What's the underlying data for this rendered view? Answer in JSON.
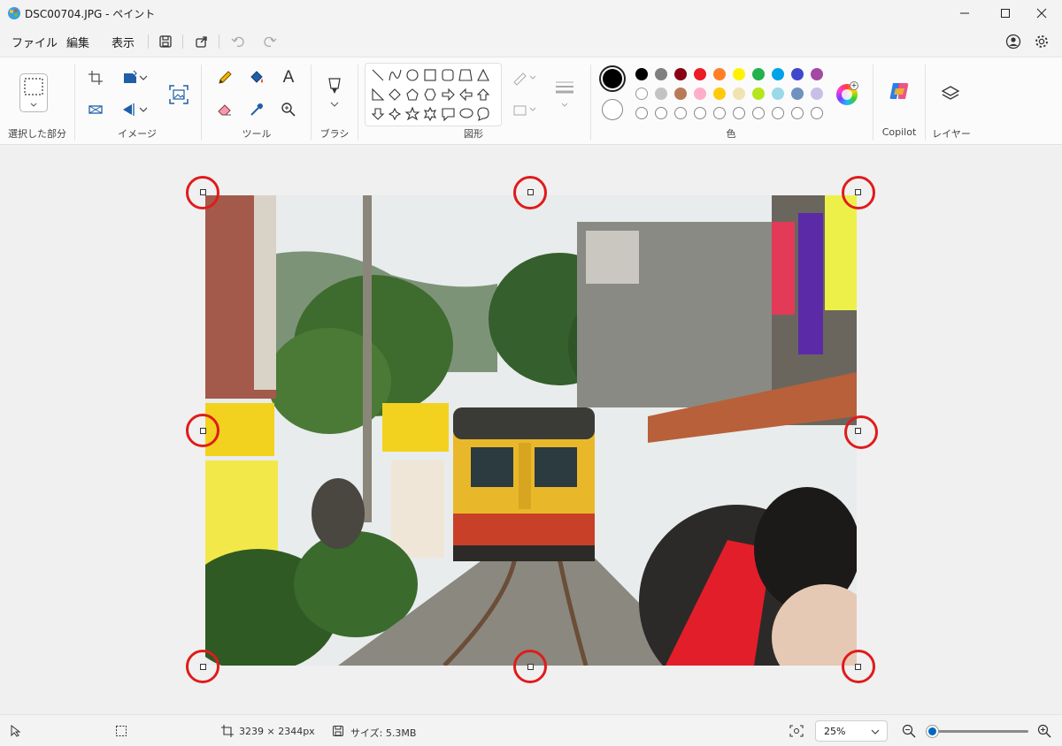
{
  "window": {
    "title": "DSC00704.JPG - ペイント"
  },
  "menu": {
    "file": "ファイル",
    "edit": "編集",
    "view": "表示"
  },
  "ribbon": {
    "selection_label": "選択した部分",
    "image_label": "イメージ",
    "tools_label": "ツール",
    "brush_label": "ブラシ",
    "shapes_label": "図形",
    "colors_label": "色",
    "copilot_label": "Copilot",
    "layers_label": "レイヤー",
    "text_tool_glyph": "A",
    "primary_color": "#000000",
    "secondary_color": "#ffffff",
    "palette_row1": [
      "#000000",
      "#7f7f7f",
      "#880015",
      "#ed1c24",
      "#ff7f27",
      "#fff200",
      "#22b14c",
      "#00a2e8",
      "#3f48cc",
      "#a349a4"
    ],
    "palette_row2": [
      "#ffffff",
      "#c3c3c3",
      "#b97a57",
      "#ffaec9",
      "#ffc90e",
      "#efe4b0",
      "#b5e61d",
      "#99d9ea",
      "#7092be",
      "#c8bfe7"
    ]
  },
  "status": {
    "dimensions": "3239 × 2344px",
    "size": "サイズ: 5.3MB",
    "zoom": "25%"
  }
}
